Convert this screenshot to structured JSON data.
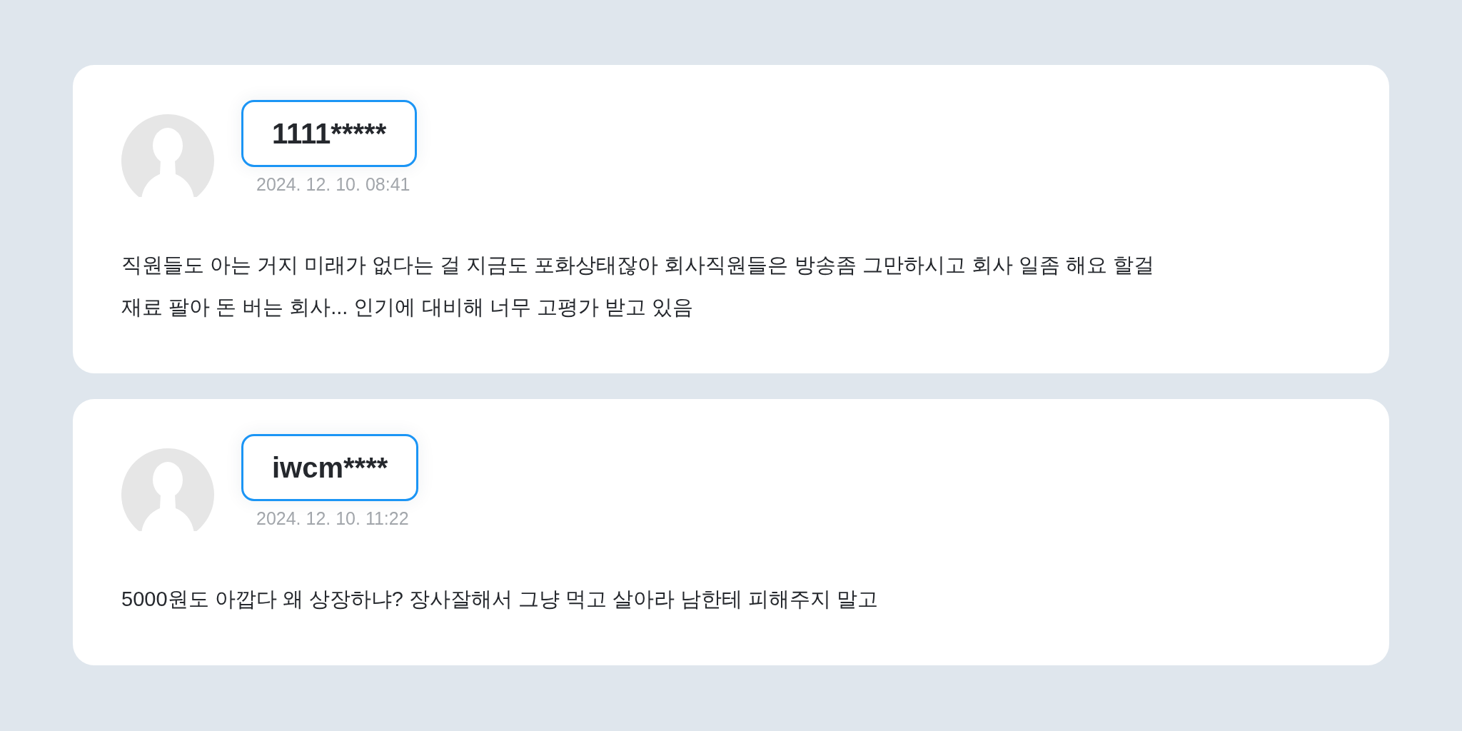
{
  "comments": [
    {
      "author": "1111*****",
      "date": "2024. 12. 10. 08:41",
      "body": "직원들도 아는 거지 미래가 없다는 걸 지금도 포화상태잖아 회사직원들은 방송좀 그만하시고 회사 일좀 해요 할걸\n재료 팔아 돈 버는 회사... 인기에 대비해 너무 고평가 받고 있음"
    },
    {
      "author": "iwcm****",
      "date": "2024. 12. 10. 11:22",
      "body": "5000원도 아깝다 왜 상장하냐? 장사잘해서 그냥 먹고 살아라 남한테 피해주지 말고"
    }
  ]
}
